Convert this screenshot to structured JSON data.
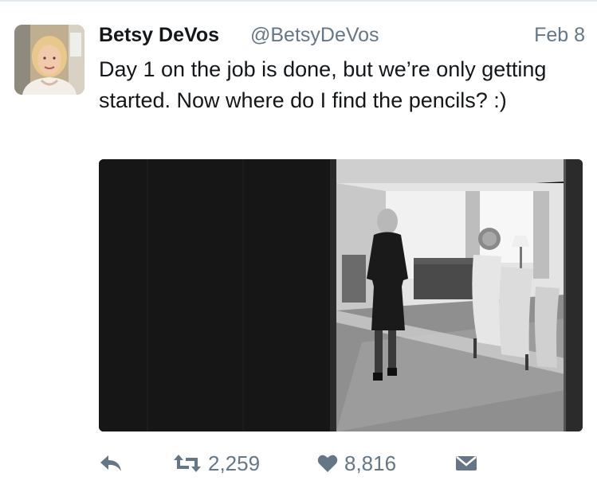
{
  "tweet": {
    "author_name": "Betsy DeVos",
    "author_handle": "@BetsyDeVos",
    "date": "Feb 8",
    "text": "Day 1 on the job is done, but we’re only getting started. Now where do I find the pencils? :)"
  },
  "actions": {
    "retweets": "2,259",
    "likes": "8,816"
  },
  "icons": {
    "reply": "reply-icon",
    "retweet": "retweet-icon",
    "like": "heart-icon",
    "message": "envelope-icon"
  },
  "colors": {
    "text": "#14171a",
    "secondary": "#657786",
    "divider": "#e1e8ed"
  }
}
